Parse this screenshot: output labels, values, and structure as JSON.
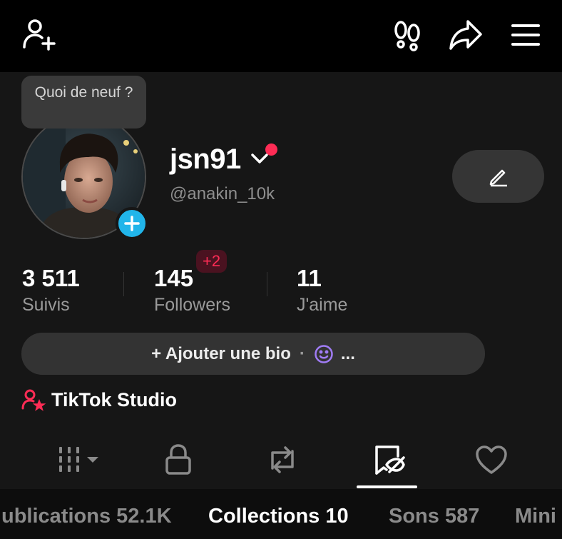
{
  "topbar": {
    "add_friend_icon": "add-user-icon",
    "footprints_icon": "footprints-icon",
    "share_icon": "share-arrow-icon",
    "menu_icon": "hamburger-menu-icon"
  },
  "profile": {
    "bubble_text": "Quoi de neuf ?",
    "nickname": "jsn91",
    "handle": "@anakin_10k",
    "new_indicator_color": "#fe2c55"
  },
  "stats": [
    {
      "value": "3 511",
      "label": "Suivis"
    },
    {
      "value": "145",
      "label": "Followers",
      "badge": "+2"
    },
    {
      "value": "11",
      "label": "J'aime"
    }
  ],
  "bio": {
    "add_label": "+ Ajouter une bio",
    "separator": "·",
    "more": "..."
  },
  "studio": {
    "label": "TikTok Studio"
  },
  "content_tabs": [
    {
      "icon": "grid-icon",
      "active": false
    },
    {
      "icon": "lock-icon",
      "active": false
    },
    {
      "icon": "repost-icon",
      "active": false
    },
    {
      "icon": "hidden-favorites-icon",
      "active": true
    },
    {
      "icon": "heart-icon",
      "active": false
    }
  ],
  "subtabs": [
    {
      "label": "ublications 52.1K",
      "active": false
    },
    {
      "label": "Collections 10",
      "active": true
    },
    {
      "label": "Sons 587",
      "active": false
    },
    {
      "label": "Mini",
      "active": false
    }
  ],
  "colors": {
    "accent_red": "#fe2c55",
    "accent_blue": "#21b5ea",
    "emoji_purple": "#a07cf5"
  }
}
